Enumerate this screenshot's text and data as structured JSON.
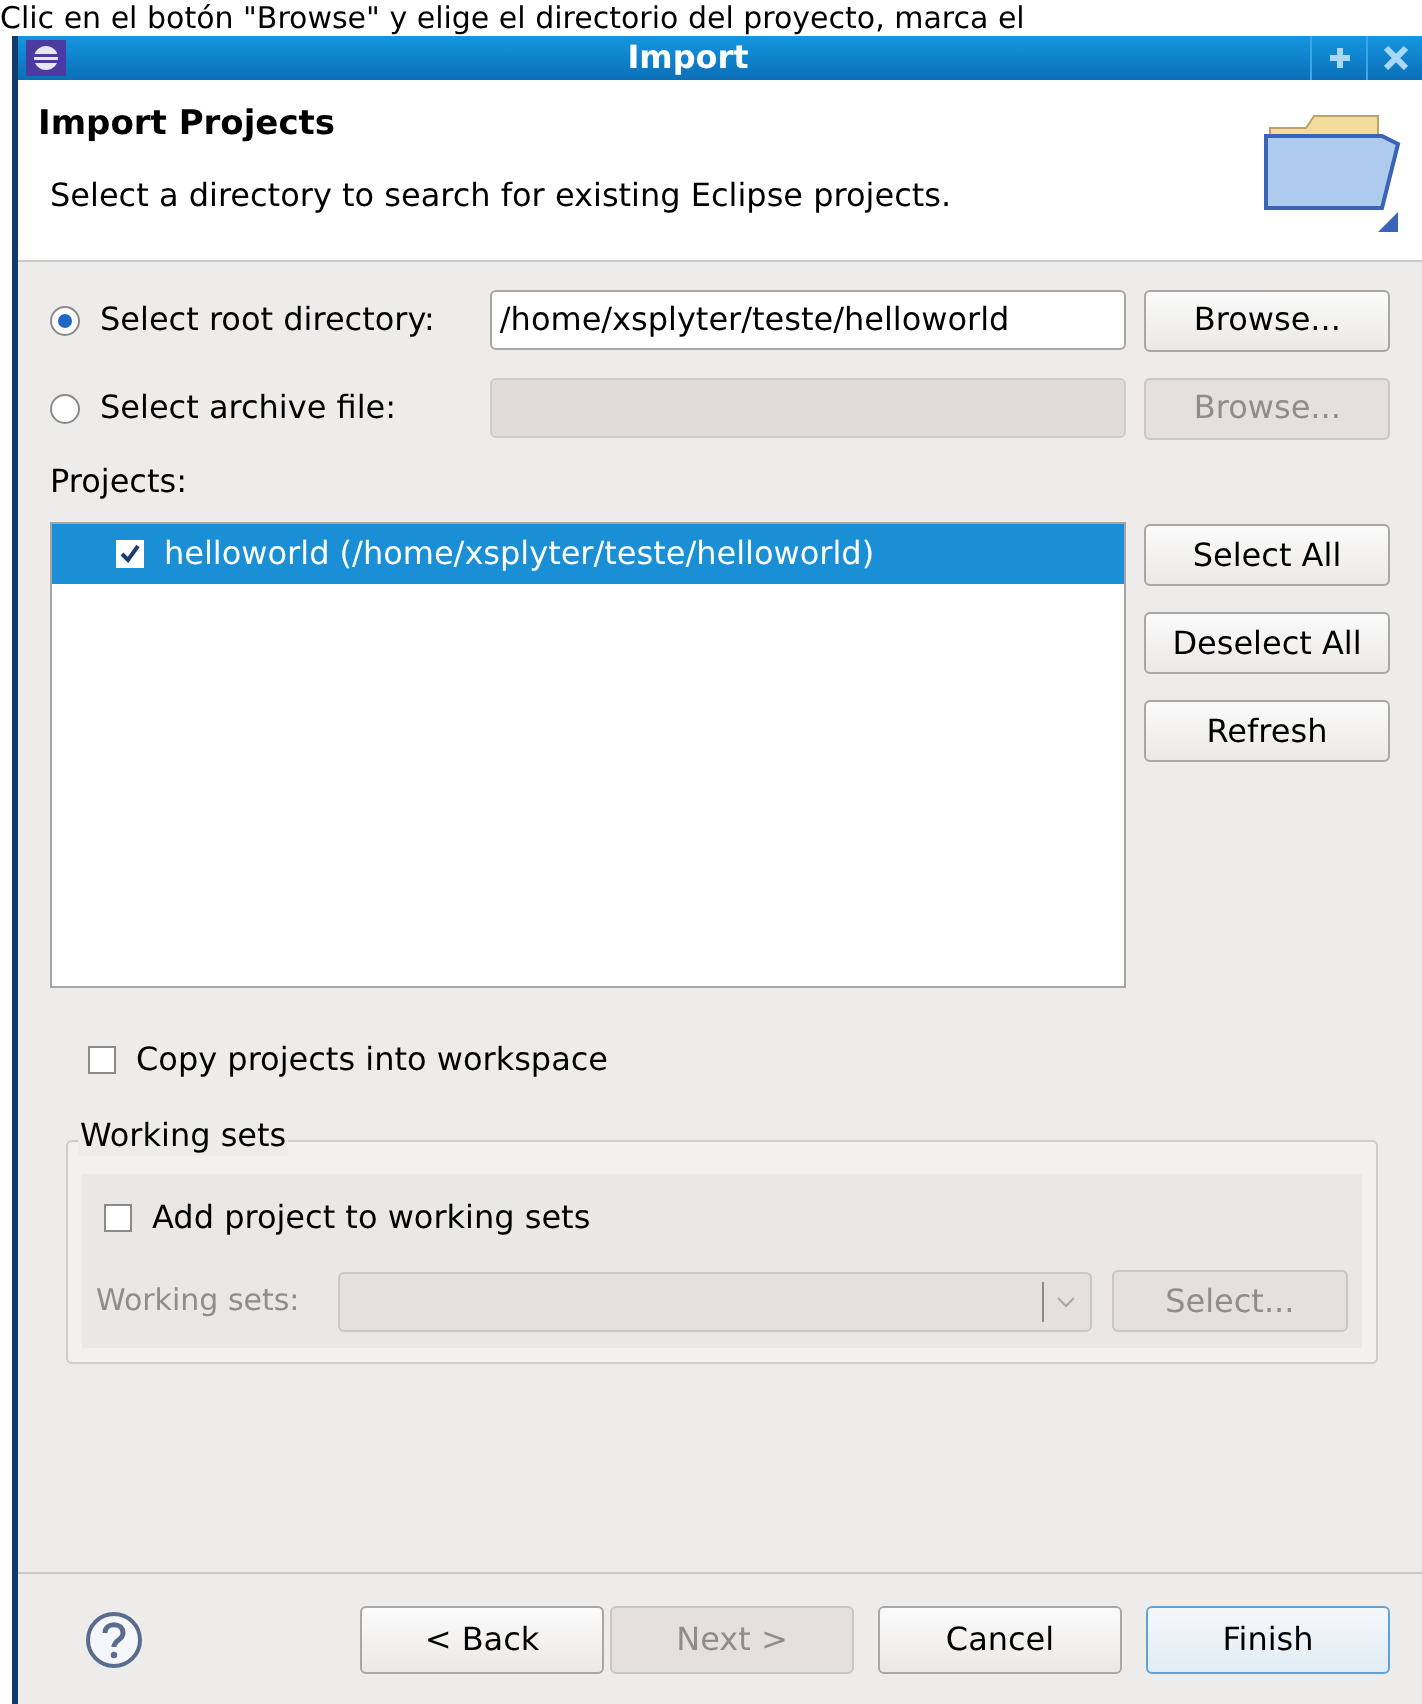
{
  "caption": "Clic en el botón \"Browse\" y elige el directorio del proyecto, marca el",
  "window": {
    "title": "Import"
  },
  "header": {
    "title": "Import Projects",
    "description": "Select a directory to search for existing Eclipse projects."
  },
  "source_options": [
    {
      "label": "Select root directory:",
      "selected": true,
      "path": "/home/xsplyter/teste/helloworld",
      "button": "Browse...",
      "disabled": false
    },
    {
      "label": "Select archive file:",
      "selected": false,
      "button": "Browse...",
      "disabled": true
    }
  ],
  "projects": {
    "label": "Projects:",
    "items": [
      {
        "label": "helloworld (/home/xsplyter/teste/helloworld)",
        "checked": true,
        "selected": true
      }
    ],
    "buttons": [
      "Select All",
      "Deselect All",
      "Refresh"
    ]
  },
  "copy_into_workspace": {
    "label": "Copy projects into workspace",
    "checked": false
  },
  "working_sets": {
    "title": "Working sets",
    "add": {
      "label": "Add project to working sets",
      "checked": false
    },
    "field_label": "Working sets:",
    "select_button": "Select...",
    "disabled": true
  },
  "footer_buttons": [
    {
      "label": "< Back",
      "disabled": false,
      "default": false
    },
    {
      "label": "Next >",
      "disabled": true,
      "default": false
    },
    {
      "label": "Cancel",
      "disabled": false,
      "default": false
    },
    {
      "label": "Finish",
      "disabled": false,
      "default": true
    }
  ]
}
